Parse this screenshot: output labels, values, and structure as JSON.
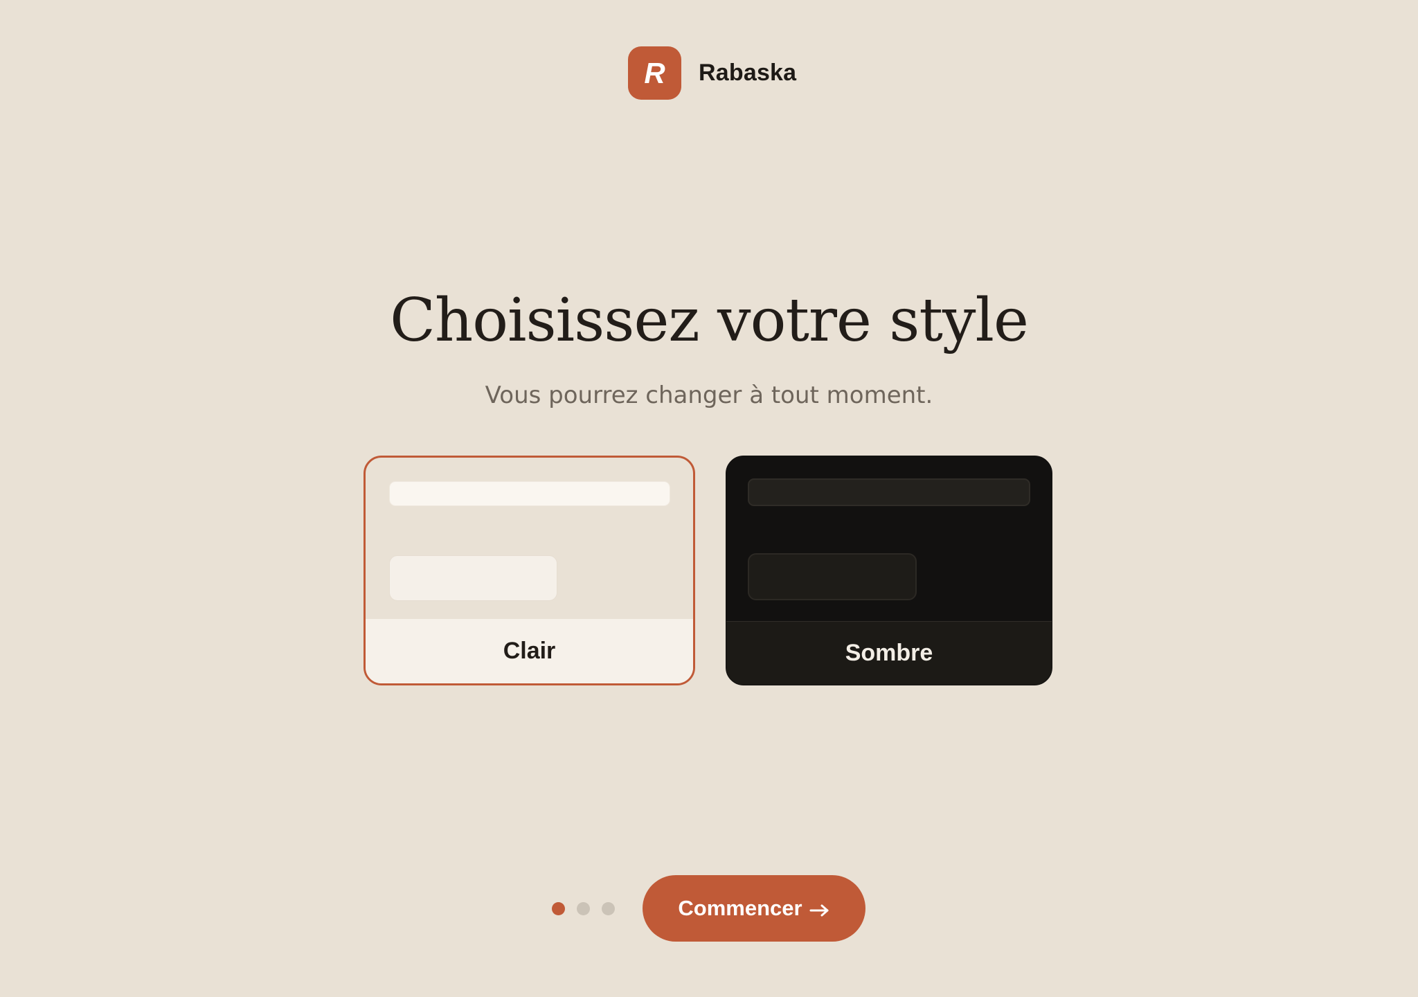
{
  "brand": {
    "logo_letter": "R",
    "name": "Rabaska"
  },
  "heading": {
    "title": "Choisissez votre style",
    "subtitle": "Vous pourrez changer à tout moment."
  },
  "themes": [
    {
      "id": "light",
      "label": "Clair",
      "selected": true
    },
    {
      "id": "dark",
      "label": "Sombre",
      "selected": false
    }
  ],
  "progress": {
    "total_steps": 3,
    "current_step": 1
  },
  "cta": {
    "label": "Commencer",
    "icon": "arrow-right-icon"
  },
  "colors": {
    "background": "#e9e1d5",
    "accent": "#c05a37",
    "text": "#221d19",
    "muted_text": "#6e655b",
    "dark_card": "#121110"
  }
}
